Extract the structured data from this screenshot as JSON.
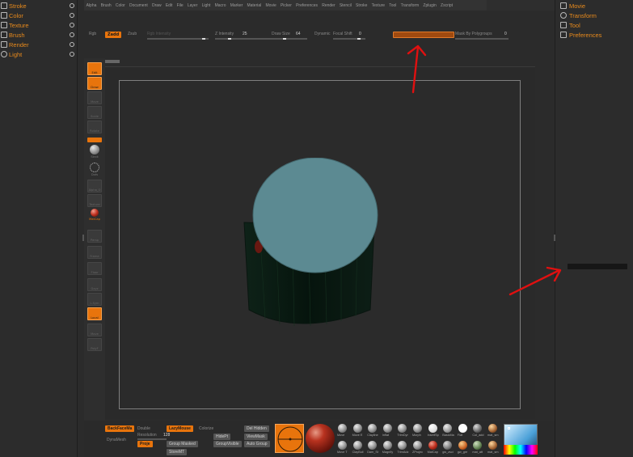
{
  "left_palette": {
    "items": [
      {
        "label": "Stroke"
      },
      {
        "label": "Color"
      },
      {
        "label": "Texture"
      },
      {
        "label": "Brush"
      },
      {
        "label": "Render"
      },
      {
        "label": "Light"
      }
    ]
  },
  "right_palette": {
    "items": [
      {
        "label": "Movie"
      },
      {
        "label": "Transform"
      },
      {
        "label": "Tool"
      },
      {
        "label": "Preferences"
      }
    ]
  },
  "menu": {
    "items": [
      "Alpha",
      "Brush",
      "Color",
      "Document",
      "Draw",
      "Edit",
      "File",
      "Layer",
      "Light",
      "Macro",
      "Marker",
      "Material",
      "Movie",
      "Picker",
      "Preferences",
      "Render",
      "Stencil",
      "Stroke",
      "Texture",
      "Tool",
      "Transform",
      "Zplugin",
      "Zscript"
    ]
  },
  "top_shelf": {
    "rgb": "Rgb",
    "zadd": "Zadd",
    "zsub": "Zsub",
    "rgb_intensity": "Rgb Intensity",
    "z_intensity_label": "Z Intensity",
    "z_intensity_value": "25",
    "draw_size_label": "Draw Size",
    "draw_size_value": "64",
    "dynamic": "Dynamic",
    "focal_shift_label": "Focal Shift",
    "focal_shift_value": "0",
    "mask_label": "Mask By Polygroups",
    "mask_value": "0"
  },
  "tool_strip": {
    "edit": "Edit",
    "draw": "Draw",
    "move": "Move",
    "scale": "Scale",
    "rotate": "Rotate",
    "sphere": "Strok",
    "dots": "Dots",
    "alpha": "Alpha_O",
    "texture": "Texture",
    "matcap": "MatCap",
    "persp": "Persp",
    "floor": "Floor",
    "local": "Local",
    "lsym": "L.Sym",
    "xyz": "Gxyz",
    "polyf": "PolyF",
    "frame": "Frame",
    "move2": "Move",
    "scale2": "Scale",
    "rotate2": "Rotate"
  },
  "bottom_shelf": {
    "backface": "BackFaceMa",
    "double": "Double",
    "dynamesh": "DynaMesh",
    "resolution_label": "Resolution",
    "resolution_value": "128",
    "project": "Proje",
    "lazymouse": "LazyMouse",
    "colorize": "Colorize",
    "group_masked": "Group Masked",
    "storemt": "StoreMT",
    "del_hidden": "Del Hidden",
    "hidept": "HidePt",
    "viewmask": "ViewMask",
    "groupvisible": "GroupVisible",
    "auto_group": "Auto Group",
    "brushes_row1": [
      "Move",
      "Move E",
      "Clayline",
      "Inflat",
      "TrimDyr",
      "Morph",
      "InsertSp",
      "BasicMa",
      "Flat",
      "Col_add",
      "mat_sm"
    ],
    "brushes_row2": [
      "Move T",
      "ClayBuil",
      "Dam_St",
      "Magnify",
      "TrimAdz",
      "ZProjec",
      "MatCap",
      "gw_zsci",
      "gw_gre",
      "mat_att",
      "mat_sm"
    ]
  },
  "colors": {
    "accent": "#e8740c",
    "palette_bg": "#2c2c2c",
    "model_cap": "#5c8a92",
    "arrow": "#e01010"
  },
  "icons": {
    "palette_item": "palette-grid-icon",
    "dock": "dock-toggle-icon"
  }
}
